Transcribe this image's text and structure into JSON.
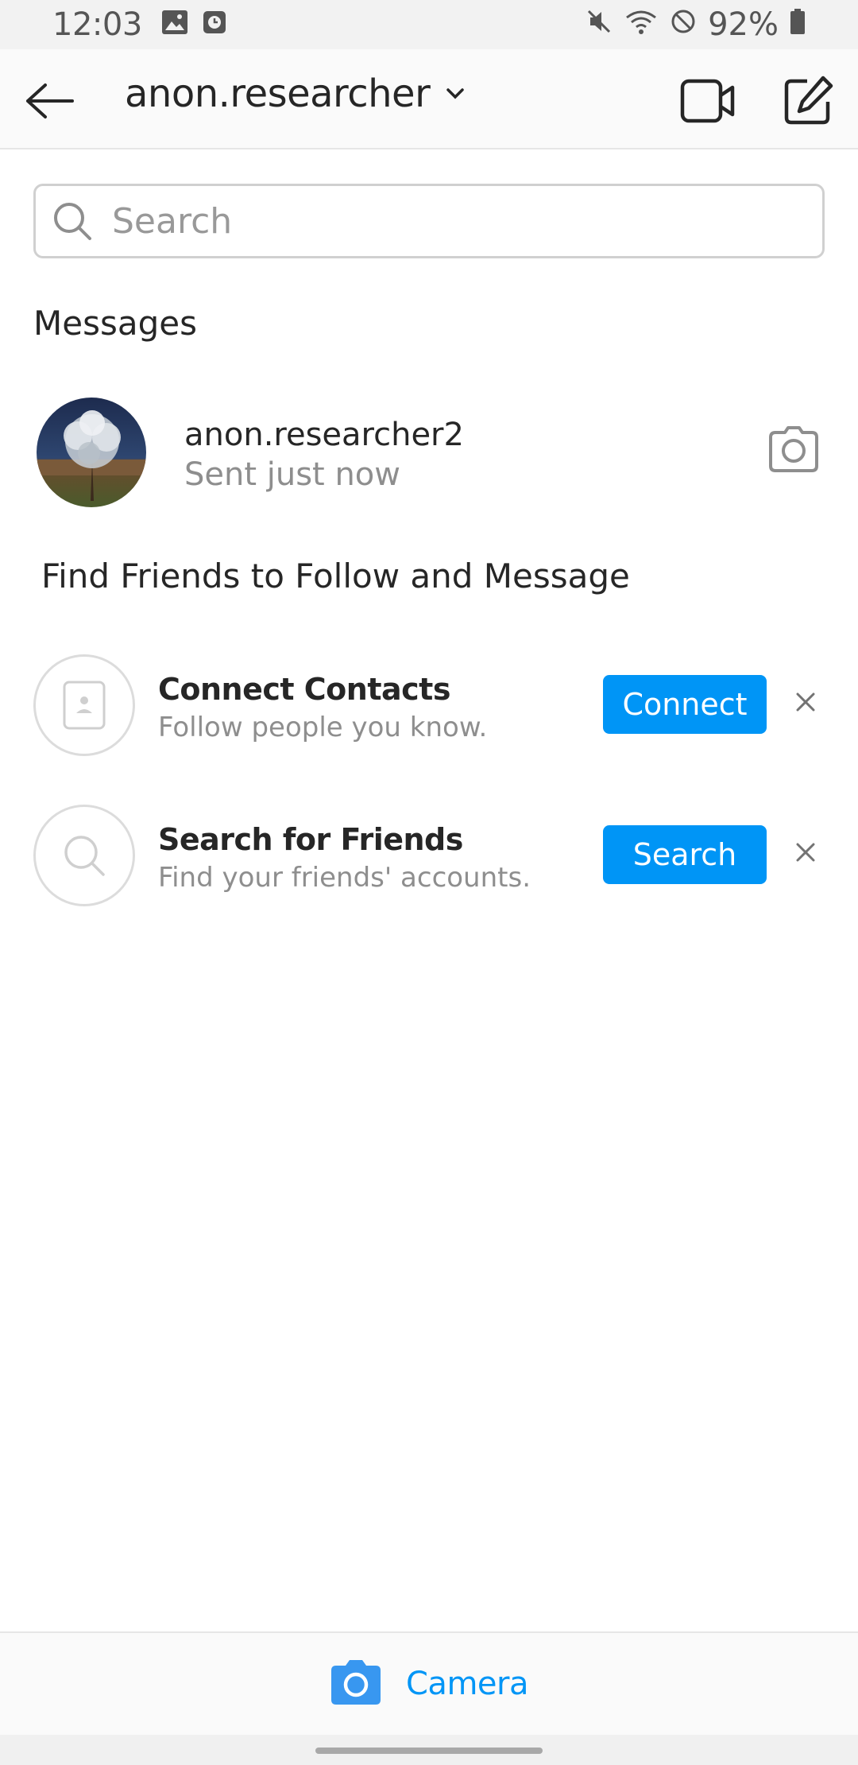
{
  "status_bar": {
    "time": "12:03",
    "battery": "92%"
  },
  "header": {
    "username": "anon.researcher"
  },
  "search": {
    "placeholder": "Search"
  },
  "messages": {
    "heading": "Messages",
    "conversations": [
      {
        "name": "anon.researcher2",
        "status": "Sent just now"
      }
    ]
  },
  "find_friends": {
    "heading": "Find Friends to Follow and Message",
    "items": [
      {
        "title": "Connect Contacts",
        "subtitle": "Follow people you know.",
        "button": "Connect",
        "icon": "contacts-icon"
      },
      {
        "title": "Search for Friends",
        "subtitle": "Find your friends' accounts.",
        "button": "Search",
        "icon": "search-icon"
      }
    ]
  },
  "bottom": {
    "camera_label": "Camera"
  },
  "colors": {
    "accent": "#0095f6",
    "text": "#262626",
    "muted": "#8e8e8e"
  }
}
